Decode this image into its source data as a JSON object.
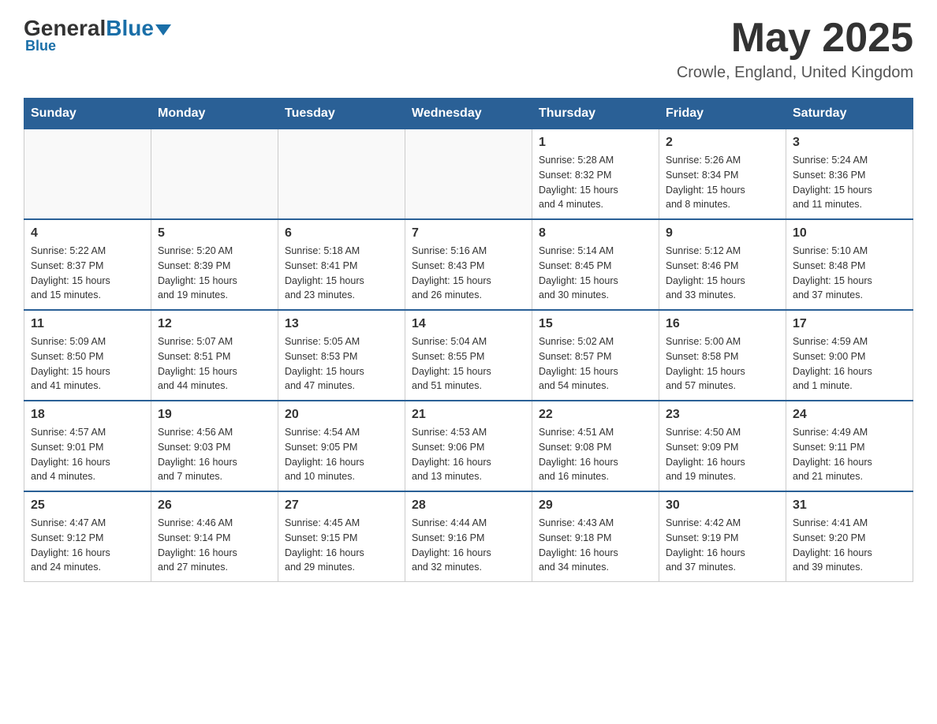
{
  "header": {
    "logo_general": "General",
    "logo_blue": "Blue",
    "month_title": "May 2025",
    "location": "Crowle, England, United Kingdom"
  },
  "days_of_week": [
    "Sunday",
    "Monday",
    "Tuesday",
    "Wednesday",
    "Thursday",
    "Friday",
    "Saturday"
  ],
  "weeks": [
    [
      {
        "day": "",
        "info": ""
      },
      {
        "day": "",
        "info": ""
      },
      {
        "day": "",
        "info": ""
      },
      {
        "day": "",
        "info": ""
      },
      {
        "day": "1",
        "info": "Sunrise: 5:28 AM\nSunset: 8:32 PM\nDaylight: 15 hours\nand 4 minutes."
      },
      {
        "day": "2",
        "info": "Sunrise: 5:26 AM\nSunset: 8:34 PM\nDaylight: 15 hours\nand 8 minutes."
      },
      {
        "day": "3",
        "info": "Sunrise: 5:24 AM\nSunset: 8:36 PM\nDaylight: 15 hours\nand 11 minutes."
      }
    ],
    [
      {
        "day": "4",
        "info": "Sunrise: 5:22 AM\nSunset: 8:37 PM\nDaylight: 15 hours\nand 15 minutes."
      },
      {
        "day": "5",
        "info": "Sunrise: 5:20 AM\nSunset: 8:39 PM\nDaylight: 15 hours\nand 19 minutes."
      },
      {
        "day": "6",
        "info": "Sunrise: 5:18 AM\nSunset: 8:41 PM\nDaylight: 15 hours\nand 23 minutes."
      },
      {
        "day": "7",
        "info": "Sunrise: 5:16 AM\nSunset: 8:43 PM\nDaylight: 15 hours\nand 26 minutes."
      },
      {
        "day": "8",
        "info": "Sunrise: 5:14 AM\nSunset: 8:45 PM\nDaylight: 15 hours\nand 30 minutes."
      },
      {
        "day": "9",
        "info": "Sunrise: 5:12 AM\nSunset: 8:46 PM\nDaylight: 15 hours\nand 33 minutes."
      },
      {
        "day": "10",
        "info": "Sunrise: 5:10 AM\nSunset: 8:48 PM\nDaylight: 15 hours\nand 37 minutes."
      }
    ],
    [
      {
        "day": "11",
        "info": "Sunrise: 5:09 AM\nSunset: 8:50 PM\nDaylight: 15 hours\nand 41 minutes."
      },
      {
        "day": "12",
        "info": "Sunrise: 5:07 AM\nSunset: 8:51 PM\nDaylight: 15 hours\nand 44 minutes."
      },
      {
        "day": "13",
        "info": "Sunrise: 5:05 AM\nSunset: 8:53 PM\nDaylight: 15 hours\nand 47 minutes."
      },
      {
        "day": "14",
        "info": "Sunrise: 5:04 AM\nSunset: 8:55 PM\nDaylight: 15 hours\nand 51 minutes."
      },
      {
        "day": "15",
        "info": "Sunrise: 5:02 AM\nSunset: 8:57 PM\nDaylight: 15 hours\nand 54 minutes."
      },
      {
        "day": "16",
        "info": "Sunrise: 5:00 AM\nSunset: 8:58 PM\nDaylight: 15 hours\nand 57 minutes."
      },
      {
        "day": "17",
        "info": "Sunrise: 4:59 AM\nSunset: 9:00 PM\nDaylight: 16 hours\nand 1 minute."
      }
    ],
    [
      {
        "day": "18",
        "info": "Sunrise: 4:57 AM\nSunset: 9:01 PM\nDaylight: 16 hours\nand 4 minutes."
      },
      {
        "day": "19",
        "info": "Sunrise: 4:56 AM\nSunset: 9:03 PM\nDaylight: 16 hours\nand 7 minutes."
      },
      {
        "day": "20",
        "info": "Sunrise: 4:54 AM\nSunset: 9:05 PM\nDaylight: 16 hours\nand 10 minutes."
      },
      {
        "day": "21",
        "info": "Sunrise: 4:53 AM\nSunset: 9:06 PM\nDaylight: 16 hours\nand 13 minutes."
      },
      {
        "day": "22",
        "info": "Sunrise: 4:51 AM\nSunset: 9:08 PM\nDaylight: 16 hours\nand 16 minutes."
      },
      {
        "day": "23",
        "info": "Sunrise: 4:50 AM\nSunset: 9:09 PM\nDaylight: 16 hours\nand 19 minutes."
      },
      {
        "day": "24",
        "info": "Sunrise: 4:49 AM\nSunset: 9:11 PM\nDaylight: 16 hours\nand 21 minutes."
      }
    ],
    [
      {
        "day": "25",
        "info": "Sunrise: 4:47 AM\nSunset: 9:12 PM\nDaylight: 16 hours\nand 24 minutes."
      },
      {
        "day": "26",
        "info": "Sunrise: 4:46 AM\nSunset: 9:14 PM\nDaylight: 16 hours\nand 27 minutes."
      },
      {
        "day": "27",
        "info": "Sunrise: 4:45 AM\nSunset: 9:15 PM\nDaylight: 16 hours\nand 29 minutes."
      },
      {
        "day": "28",
        "info": "Sunrise: 4:44 AM\nSunset: 9:16 PM\nDaylight: 16 hours\nand 32 minutes."
      },
      {
        "day": "29",
        "info": "Sunrise: 4:43 AM\nSunset: 9:18 PM\nDaylight: 16 hours\nand 34 minutes."
      },
      {
        "day": "30",
        "info": "Sunrise: 4:42 AM\nSunset: 9:19 PM\nDaylight: 16 hours\nand 37 minutes."
      },
      {
        "day": "31",
        "info": "Sunrise: 4:41 AM\nSunset: 9:20 PM\nDaylight: 16 hours\nand 39 minutes."
      }
    ]
  ]
}
